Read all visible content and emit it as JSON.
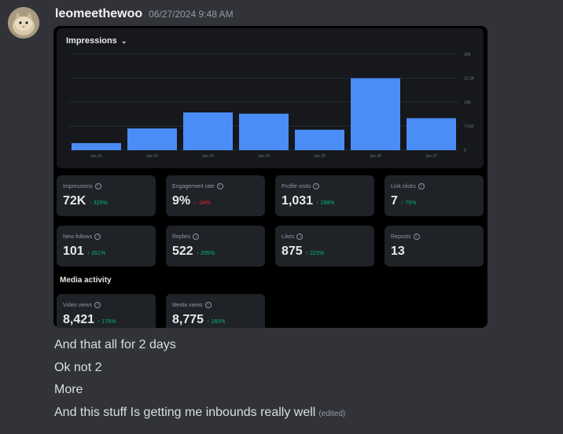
{
  "message": {
    "username": "leomeethewoo",
    "timestamp": "06/27/2024 9:48 AM",
    "lines": [
      "And that all for 2 days",
      "Ok not 2",
      "More",
      "And this stuff Is getting me inbounds really well"
    ],
    "edited_label": "(edited)"
  },
  "attachment": {
    "chart_title": "Impressions",
    "section_title": "Media activity",
    "stats": [
      {
        "label": "Impressions",
        "value": "72K",
        "change": "↑ 325%",
        "dir": "up"
      },
      {
        "label": "Engagement rate",
        "value": "9%",
        "change": "↓ -34%",
        "dir": "down"
      },
      {
        "label": "Profile visits",
        "value": "1,031",
        "change": "↑ 298%",
        "dir": "up"
      },
      {
        "label": "Link clicks",
        "value": "7",
        "change": "↑ 75%",
        "dir": "up"
      },
      {
        "label": "New follows",
        "value": "101",
        "change": "↑ 261%",
        "dir": "up"
      },
      {
        "label": "Replies",
        "value": "522",
        "change": "↑ 295%",
        "dir": "up"
      },
      {
        "label": "Likes",
        "value": "875",
        "change": "↑ 223%",
        "dir": "up"
      },
      {
        "label": "Reposts",
        "value": "13",
        "change": "",
        "dir": "up"
      },
      {
        "label": "Video views",
        "value": "8,421",
        "change": "↑ 176%",
        "dir": "up"
      },
      {
        "label": "Media views",
        "value": "8,775",
        "change": "↑ 160%",
        "dir": "up"
      }
    ]
  },
  "chart_data": {
    "type": "bar",
    "title": "Impressions",
    "categories": [
      "Jun 21",
      "Jun 22",
      "Jun 23",
      "Jun 24",
      "Jun 25",
      "Jun 26",
      "Jun 27"
    ],
    "values": [
      2200,
      6800,
      11800,
      11400,
      6400,
      22500,
      10000
    ],
    "yticks": [
      0,
      7500,
      15000,
      22500,
      30000
    ],
    "ytick_labels": [
      "0",
      "7,500",
      "15K",
      "22.5K",
      "30K"
    ],
    "ylim": [
      0,
      30000
    ],
    "color": "#4a8df6",
    "grid": true
  }
}
